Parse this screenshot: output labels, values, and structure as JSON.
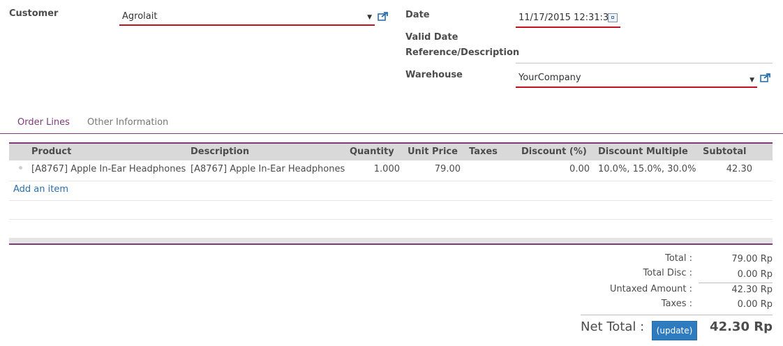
{
  "form": {
    "customer_label": "Customer",
    "customer_value": "Agrolait",
    "date_label": "Date",
    "date_value": "11/17/2015 12:31:32",
    "valid_date_label": "Valid Date",
    "reference_label": "Reference/Description",
    "warehouse_label": "Warehouse",
    "warehouse_value": "YourCompany"
  },
  "icons": {
    "dropdown": "caret-down-icon",
    "external": "external-link-icon",
    "calendar": "calendar-icon"
  },
  "tabs": [
    {
      "label": "Order Lines",
      "active": true
    },
    {
      "label": "Other Information",
      "active": false
    }
  ],
  "table": {
    "headers": [
      "Product",
      "Description",
      "Quantity",
      "Unit Price",
      "Taxes",
      "Discount (%)",
      "Discount Multiple",
      "Subtotal"
    ],
    "rows": [
      {
        "product": "[A8767] Apple In-Ear Headphones",
        "description": "[A8767] Apple In-Ear Headphones",
        "quantity": "1.000",
        "unit_price": "79.00",
        "taxes": "",
        "discount": "0.00",
        "discount_multiple": "10.0%, 15.0%, 30.0%",
        "subtotal": "42.30"
      }
    ],
    "add_item_label": "Add an item"
  },
  "totals": {
    "total_label": "Total :",
    "total_value": "79.00 Rp",
    "total_disc_label": "Total Disc :",
    "total_disc_value": "0.00 Rp",
    "untaxed_label": "Untaxed Amount :",
    "untaxed_value": "42.30 Rp",
    "taxes_label": "Taxes :",
    "taxes_value": "0.00 Rp",
    "net_total_label": "Net Total :",
    "update_label": "(update)",
    "net_total_value": "42.30 Rp"
  },
  "colors": {
    "accent": "#7c3b76",
    "required_underline": "#c0111f",
    "link": "#2a6fb0",
    "button": "#2f7bbf",
    "table_header_bg": "#d9d9d9"
  }
}
